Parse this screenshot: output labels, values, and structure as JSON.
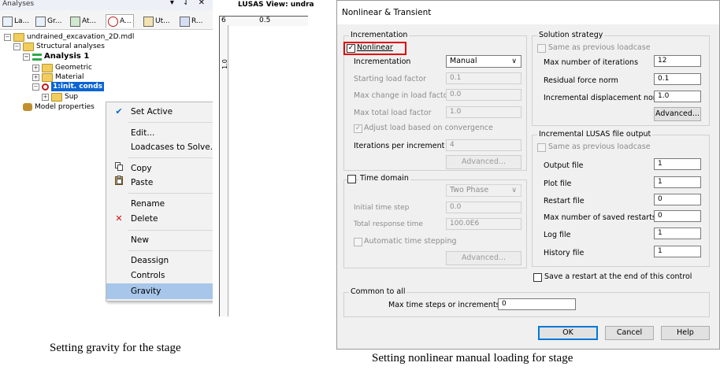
{
  "tree_panel": {
    "title": "Analyses",
    "controls": "▾ ⇃ ✕",
    "tabs": [
      "La...",
      "Gr...",
      "At...",
      "A...",
      "Ut...",
      "R..."
    ],
    "items": [
      "undrained_excavation_2D.mdl",
      "Structural analyses",
      "Analysis 1",
      "Geometric",
      "Material",
      "1:init. conds",
      "Sup",
      "Model properties"
    ]
  },
  "context_menu": {
    "items": [
      "Set Active",
      "Edit...",
      "Loadcases to Solve...",
      "Copy",
      "Paste",
      "Rename",
      "Delete",
      "New",
      "Deassign",
      "Controls",
      "Gravity"
    ],
    "check_glyph": "✔",
    "delete_glyph": "✕",
    "submenu_glyph": "›"
  },
  "view_panel": {
    "title": "LUSAS View: undra",
    "ruler_values": [
      "6",
      "0.5"
    ],
    "v_ruler_value": "1.0"
  },
  "dialog": {
    "title": "Nonlinear & Transient",
    "incrementation": {
      "group_label": "Incrementation",
      "nonlinear_label": "Nonlinear",
      "nonlinear_checked": true,
      "incrementation_label": "Incrementation",
      "incrementation_value": "Manual",
      "starting_load_label": "Starting load factor",
      "starting_load_value": "0.1",
      "max_change_label": "Max change in load factor",
      "max_change_value": "0.0",
      "max_total_label": "Max total load factor",
      "max_total_value": "1.0",
      "adjust_label": "Adjust load based on convergence",
      "iterations_label": "Iterations per increment",
      "iterations_value": "4",
      "advanced_label": "Advanced..."
    },
    "time_domain": {
      "label": "Time domain",
      "phase_value": "Two Phase",
      "initial_step_label": "Initial time step",
      "initial_step_value": "0.0",
      "total_time_label": "Total response time",
      "total_time_value": "100.0E6",
      "auto_step_label": "Automatic time stepping",
      "advanced_label": "Advanced..."
    },
    "solution_strategy": {
      "group_label": "Solution strategy",
      "same_label": "Same as previous loadcase",
      "max_iter_label": "Max number of iterations",
      "max_iter_value": "12",
      "residual_label": "Residual force norm",
      "residual_value": "0.1",
      "displacement_label": "Incremental displacement norm",
      "displacement_value": "1.0",
      "advanced_label": "Advanced..."
    },
    "file_output": {
      "group_label": "Incremental LUSAS file output",
      "same_label": "Same as previous loadcase",
      "output_label": "Output file",
      "output_value": "1",
      "plot_label": "Plot file",
      "plot_value": "1",
      "restart_label": "Restart file",
      "restart_value": "0",
      "max_restarts_label": "Max number of saved restarts",
      "max_restarts_value": "0",
      "log_label": "Log file",
      "log_value": "1",
      "history_label": "History file",
      "history_value": "1"
    },
    "save_restart_label": "Save a restart at the end of this control",
    "common": {
      "group_label": "Common to all",
      "max_steps_label": "Max time steps or increments",
      "max_steps_value": "0"
    },
    "buttons": {
      "ok": "OK",
      "cancel": "Cancel",
      "help": "Help"
    }
  },
  "captions": {
    "left": "Setting gravity for the stage",
    "right": "Setting nonlinear manual loading for stage"
  },
  "colors": {
    "highlight": "#a7c6ea",
    "selection": "#0a64d2",
    "red_box": "#e00000",
    "default_button": "#0078d7"
  }
}
